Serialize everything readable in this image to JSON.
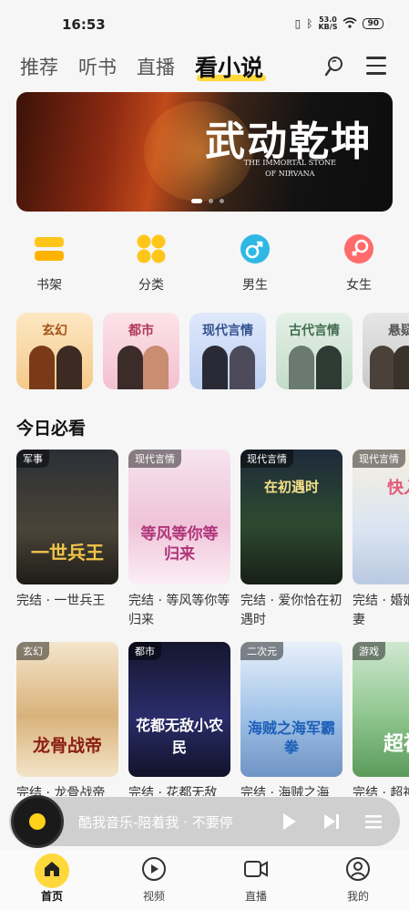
{
  "status_bar": {
    "time": "16:53",
    "net_speed_value": "53.0",
    "net_speed_unit": "KB/S",
    "battery": "90"
  },
  "top_nav": {
    "tabs": [
      {
        "label": "推荐"
      },
      {
        "label": "听书"
      },
      {
        "label": "直播"
      },
      {
        "label": "看小说",
        "active": true
      }
    ],
    "accent_color": "#ffd83b"
  },
  "banner": {
    "title": "武动乾坤",
    "subtitle_line1": "THE IMMORTAL STONE",
    "subtitle_line2": "OF NIRVANA"
  },
  "quick_actions": [
    {
      "label": "书架",
      "icon": "bookshelf-icon",
      "color": "#ffc61a"
    },
    {
      "label": "分类",
      "icon": "category-icon",
      "color": "#ffc61a"
    },
    {
      "label": "男生",
      "icon": "male-icon",
      "color": "#2fb8e6"
    },
    {
      "label": "女生",
      "icon": "female-icon",
      "color": "#ff6b6b"
    }
  ],
  "genres": [
    {
      "label": "玄幻"
    },
    {
      "label": "都市"
    },
    {
      "label": "现代言情"
    },
    {
      "label": "古代言情"
    },
    {
      "label": "悬疑"
    }
  ],
  "section": {
    "title": "今日必看"
  },
  "books": [
    {
      "tag": "军事",
      "cover_text": "一世兵王",
      "title": "完结 · 一世兵王"
    },
    {
      "tag": "现代言情",
      "cover_text": "等风等你等归来",
      "title": "完结 · 等风等你等归来"
    },
    {
      "tag": "现代言情",
      "cover_text": "在初遇时",
      "title": "完结 · 爱你恰在初遇时"
    },
    {
      "tag": "现代言情",
      "cover_text": "快入",
      "title": "完结 · 婚姻宠：甜妻"
    },
    {
      "tag": "玄幻",
      "cover_text": "龙骨战帝",
      "title": "完结 · 龙骨战帝"
    },
    {
      "tag": "都市",
      "cover_text": "花都无敌小农民",
      "title": "完结 · 花都无敌"
    },
    {
      "tag": "二次元",
      "cover_text": "海贼之海军霸拳",
      "title": "完结 · 海贼之海"
    },
    {
      "tag": "游戏",
      "cover_text": "超神",
      "title": "完结 · 超神"
    }
  ],
  "player": {
    "song": "酷我音乐-陪着我 · 不要停"
  },
  "bottom_nav": [
    {
      "label": "首页",
      "icon": "home-icon",
      "active": true
    },
    {
      "label": "视频",
      "icon": "video-icon"
    },
    {
      "label": "直播",
      "icon": "live-icon"
    },
    {
      "label": "我的",
      "icon": "profile-icon"
    }
  ]
}
